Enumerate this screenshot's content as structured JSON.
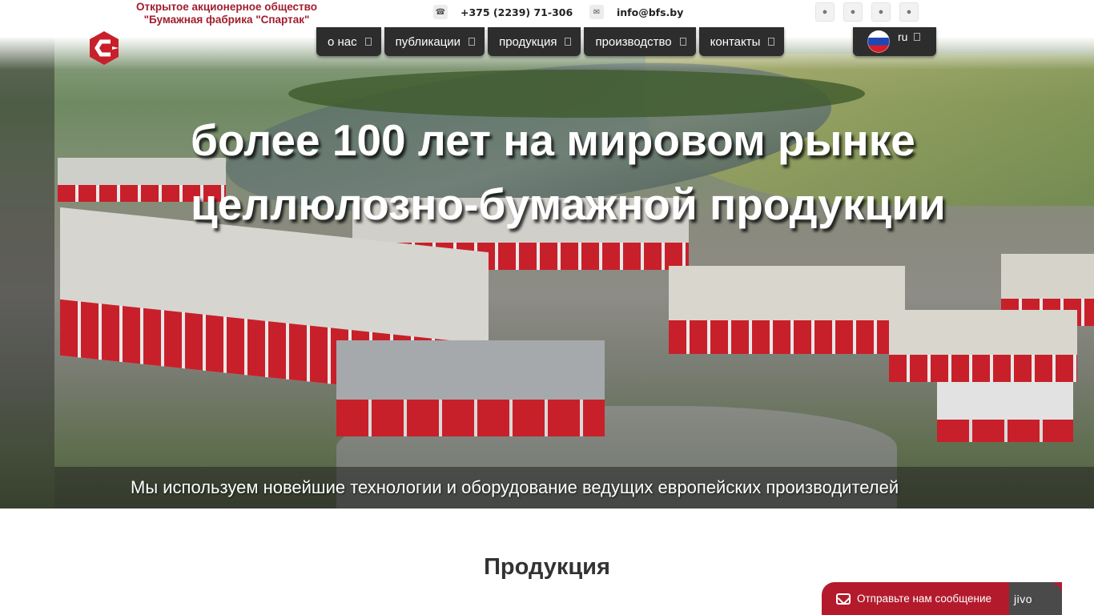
{
  "company": {
    "line1": "Открытое акционерное общество",
    "line2": "\"Бумажная фабрика \"Спартак\""
  },
  "contacts": {
    "phone": "+375 (2239) 71-306",
    "email": "info@bfs.by",
    "phone_icon": "phone-icon",
    "email_icon": "envelope-icon"
  },
  "socials": [
    {
      "name": "social-icon-1"
    },
    {
      "name": "social-icon-2"
    },
    {
      "name": "social-icon-3"
    },
    {
      "name": "social-icon-4"
    }
  ],
  "nav": {
    "items": [
      {
        "label": "о нас"
      },
      {
        "label": "публикации"
      },
      {
        "label": "продукция"
      },
      {
        "label": "производство"
      },
      {
        "label": "контакты"
      }
    ],
    "language": {
      "code": "ru",
      "flag": "russia-flag-icon"
    }
  },
  "hero": {
    "title_line1": "более 100 лет на мировом рынке",
    "title_line2": "целлюлозно-бумажной продукции",
    "subtitle": "Мы используем новейшие технологии и оборудование ведущих европейских производителей"
  },
  "section": {
    "title": "Продукция"
  },
  "chat": {
    "label": "Отправьте нам сообщение",
    "brand": "jivo"
  },
  "colors": {
    "brand_red": "#a01e2e",
    "nav_bg": "#2d2d2d",
    "chat_red": "#b31b2c"
  }
}
